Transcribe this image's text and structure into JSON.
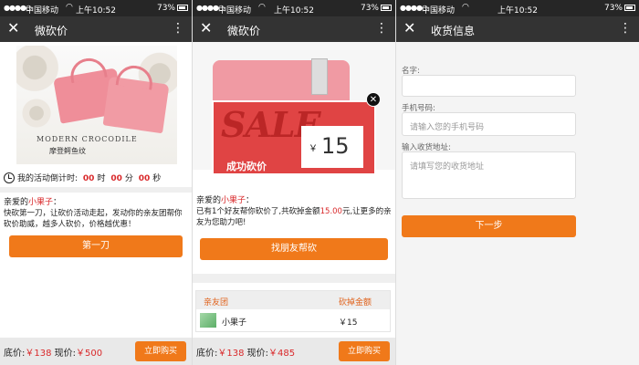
{
  "status": {
    "carrier": "中国移动",
    "time": "上午10:52",
    "battery": "73%"
  },
  "panel1": {
    "title": "微砍价",
    "product_caption_en": "MODERN CROCODILE",
    "product_caption_cn": "摩登鳄鱼纹",
    "timer": {
      "label": "我的活动倒计时:",
      "hours": "00",
      "h_unit": "时",
      "minutes": "00",
      "m_unit": "分",
      "seconds": "00",
      "s_unit": "秒"
    },
    "greeting_prefix": "亲爱的",
    "nickname": "小果子",
    "greeting_suffix": "：",
    "message": "快砍第一刀，让砍价活动走起，发动你的亲友团帮你砍价助威，越多人砍价，价格越优惠！",
    "cut_button": "第一刀",
    "floor_label": "底价:",
    "floor_price": "￥138",
    "current_label": "现价:",
    "current_price": "￥500",
    "buy_button": "立即购买"
  },
  "panel2": {
    "title": "微砍价",
    "popup_sale": "SALE",
    "popup_label": "成功砍价",
    "popup_yen": "￥",
    "popup_amount": "15",
    "greeting_prefix": "亲爱的",
    "nickname": "小果子",
    "greeting_suffix": "：",
    "message_a": "已有1个好友帮你砍价了,共砍掉金额",
    "message_amount": "15.00",
    "message_b": "元,让更多的亲友为您助力吧!",
    "help_button": "找朋友帮砍",
    "friends_header_name": "亲友团",
    "friends_header_amount": "砍掉金额",
    "friends": [
      {
        "name": "小果子",
        "amount": "￥15"
      }
    ],
    "floor_label": "底价:",
    "floor_price": "￥138",
    "current_label": "现价:",
    "current_price": "￥485",
    "buy_button": "立即购买"
  },
  "panel3": {
    "title": "收货信息",
    "name_label": "名字:",
    "phone_label": "手机号码:",
    "phone_placeholder": "请输入您的手机号码",
    "address_label": "输入收货地址:",
    "address_placeholder": "请填写您的收货地址",
    "next_button": "下一步"
  },
  "colors": {
    "accent": "#f0791a",
    "red": "#d9292b",
    "titlebar": "#333333"
  }
}
